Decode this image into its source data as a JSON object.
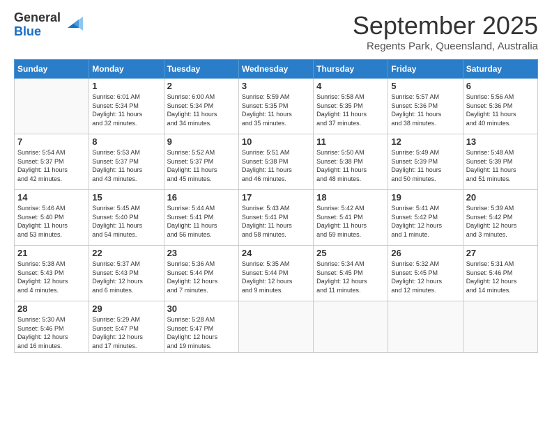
{
  "logo": {
    "general": "General",
    "blue": "Blue"
  },
  "title": "September 2025",
  "subtitle": "Regents Park, Queensland, Australia",
  "days_of_week": [
    "Sunday",
    "Monday",
    "Tuesday",
    "Wednesday",
    "Thursday",
    "Friday",
    "Saturday"
  ],
  "weeks": [
    [
      {
        "day": "",
        "info": ""
      },
      {
        "day": "1",
        "info": "Sunrise: 6:01 AM\nSunset: 5:34 PM\nDaylight: 11 hours\nand 32 minutes."
      },
      {
        "day": "2",
        "info": "Sunrise: 6:00 AM\nSunset: 5:34 PM\nDaylight: 11 hours\nand 34 minutes."
      },
      {
        "day": "3",
        "info": "Sunrise: 5:59 AM\nSunset: 5:35 PM\nDaylight: 11 hours\nand 35 minutes."
      },
      {
        "day": "4",
        "info": "Sunrise: 5:58 AM\nSunset: 5:35 PM\nDaylight: 11 hours\nand 37 minutes."
      },
      {
        "day": "5",
        "info": "Sunrise: 5:57 AM\nSunset: 5:36 PM\nDaylight: 11 hours\nand 38 minutes."
      },
      {
        "day": "6",
        "info": "Sunrise: 5:56 AM\nSunset: 5:36 PM\nDaylight: 11 hours\nand 40 minutes."
      }
    ],
    [
      {
        "day": "7",
        "info": "Sunrise: 5:54 AM\nSunset: 5:37 PM\nDaylight: 11 hours\nand 42 minutes."
      },
      {
        "day": "8",
        "info": "Sunrise: 5:53 AM\nSunset: 5:37 PM\nDaylight: 11 hours\nand 43 minutes."
      },
      {
        "day": "9",
        "info": "Sunrise: 5:52 AM\nSunset: 5:37 PM\nDaylight: 11 hours\nand 45 minutes."
      },
      {
        "day": "10",
        "info": "Sunrise: 5:51 AM\nSunset: 5:38 PM\nDaylight: 11 hours\nand 46 minutes."
      },
      {
        "day": "11",
        "info": "Sunrise: 5:50 AM\nSunset: 5:38 PM\nDaylight: 11 hours\nand 48 minutes."
      },
      {
        "day": "12",
        "info": "Sunrise: 5:49 AM\nSunset: 5:39 PM\nDaylight: 11 hours\nand 50 minutes."
      },
      {
        "day": "13",
        "info": "Sunrise: 5:48 AM\nSunset: 5:39 PM\nDaylight: 11 hours\nand 51 minutes."
      }
    ],
    [
      {
        "day": "14",
        "info": "Sunrise: 5:46 AM\nSunset: 5:40 PM\nDaylight: 11 hours\nand 53 minutes."
      },
      {
        "day": "15",
        "info": "Sunrise: 5:45 AM\nSunset: 5:40 PM\nDaylight: 11 hours\nand 54 minutes."
      },
      {
        "day": "16",
        "info": "Sunrise: 5:44 AM\nSunset: 5:41 PM\nDaylight: 11 hours\nand 56 minutes."
      },
      {
        "day": "17",
        "info": "Sunrise: 5:43 AM\nSunset: 5:41 PM\nDaylight: 11 hours\nand 58 minutes."
      },
      {
        "day": "18",
        "info": "Sunrise: 5:42 AM\nSunset: 5:41 PM\nDaylight: 11 hours\nand 59 minutes."
      },
      {
        "day": "19",
        "info": "Sunrise: 5:41 AM\nSunset: 5:42 PM\nDaylight: 12 hours\nand 1 minute."
      },
      {
        "day": "20",
        "info": "Sunrise: 5:39 AM\nSunset: 5:42 PM\nDaylight: 12 hours\nand 3 minutes."
      }
    ],
    [
      {
        "day": "21",
        "info": "Sunrise: 5:38 AM\nSunset: 5:43 PM\nDaylight: 12 hours\nand 4 minutes."
      },
      {
        "day": "22",
        "info": "Sunrise: 5:37 AM\nSunset: 5:43 PM\nDaylight: 12 hours\nand 6 minutes."
      },
      {
        "day": "23",
        "info": "Sunrise: 5:36 AM\nSunset: 5:44 PM\nDaylight: 12 hours\nand 7 minutes."
      },
      {
        "day": "24",
        "info": "Sunrise: 5:35 AM\nSunset: 5:44 PM\nDaylight: 12 hours\nand 9 minutes."
      },
      {
        "day": "25",
        "info": "Sunrise: 5:34 AM\nSunset: 5:45 PM\nDaylight: 12 hours\nand 11 minutes."
      },
      {
        "day": "26",
        "info": "Sunrise: 5:32 AM\nSunset: 5:45 PM\nDaylight: 12 hours\nand 12 minutes."
      },
      {
        "day": "27",
        "info": "Sunrise: 5:31 AM\nSunset: 5:46 PM\nDaylight: 12 hours\nand 14 minutes."
      }
    ],
    [
      {
        "day": "28",
        "info": "Sunrise: 5:30 AM\nSunset: 5:46 PM\nDaylight: 12 hours\nand 16 minutes."
      },
      {
        "day": "29",
        "info": "Sunrise: 5:29 AM\nSunset: 5:47 PM\nDaylight: 12 hours\nand 17 minutes."
      },
      {
        "day": "30",
        "info": "Sunrise: 5:28 AM\nSunset: 5:47 PM\nDaylight: 12 hours\nand 19 minutes."
      },
      {
        "day": "",
        "info": ""
      },
      {
        "day": "",
        "info": ""
      },
      {
        "day": "",
        "info": ""
      },
      {
        "day": "",
        "info": ""
      }
    ]
  ]
}
